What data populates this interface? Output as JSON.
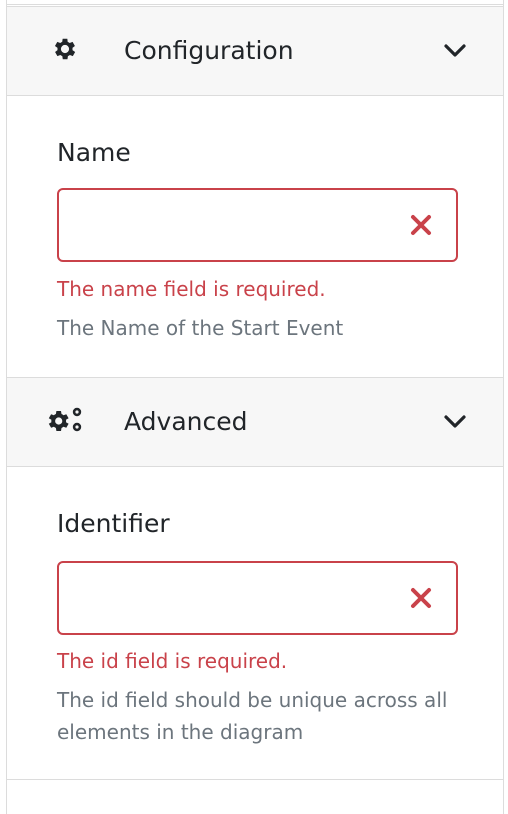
{
  "sections": {
    "configuration": {
      "title": "Configuration",
      "icon": "gear-icon",
      "field": {
        "label": "Name",
        "value": "",
        "error": "The name field is required.",
        "help": "The Name of the Start Event"
      }
    },
    "advanced": {
      "title": "Advanced",
      "icon": "gears-icon",
      "field": {
        "label": "Identifier",
        "value": "",
        "error": "The id field is required.",
        "help": "The id field should be unique across all elements in the diagram"
      }
    }
  },
  "colors": {
    "error": "#c9424a",
    "help": "#6c757d",
    "header_bg": "#f7f7f7",
    "border": "#dcdcdc"
  }
}
